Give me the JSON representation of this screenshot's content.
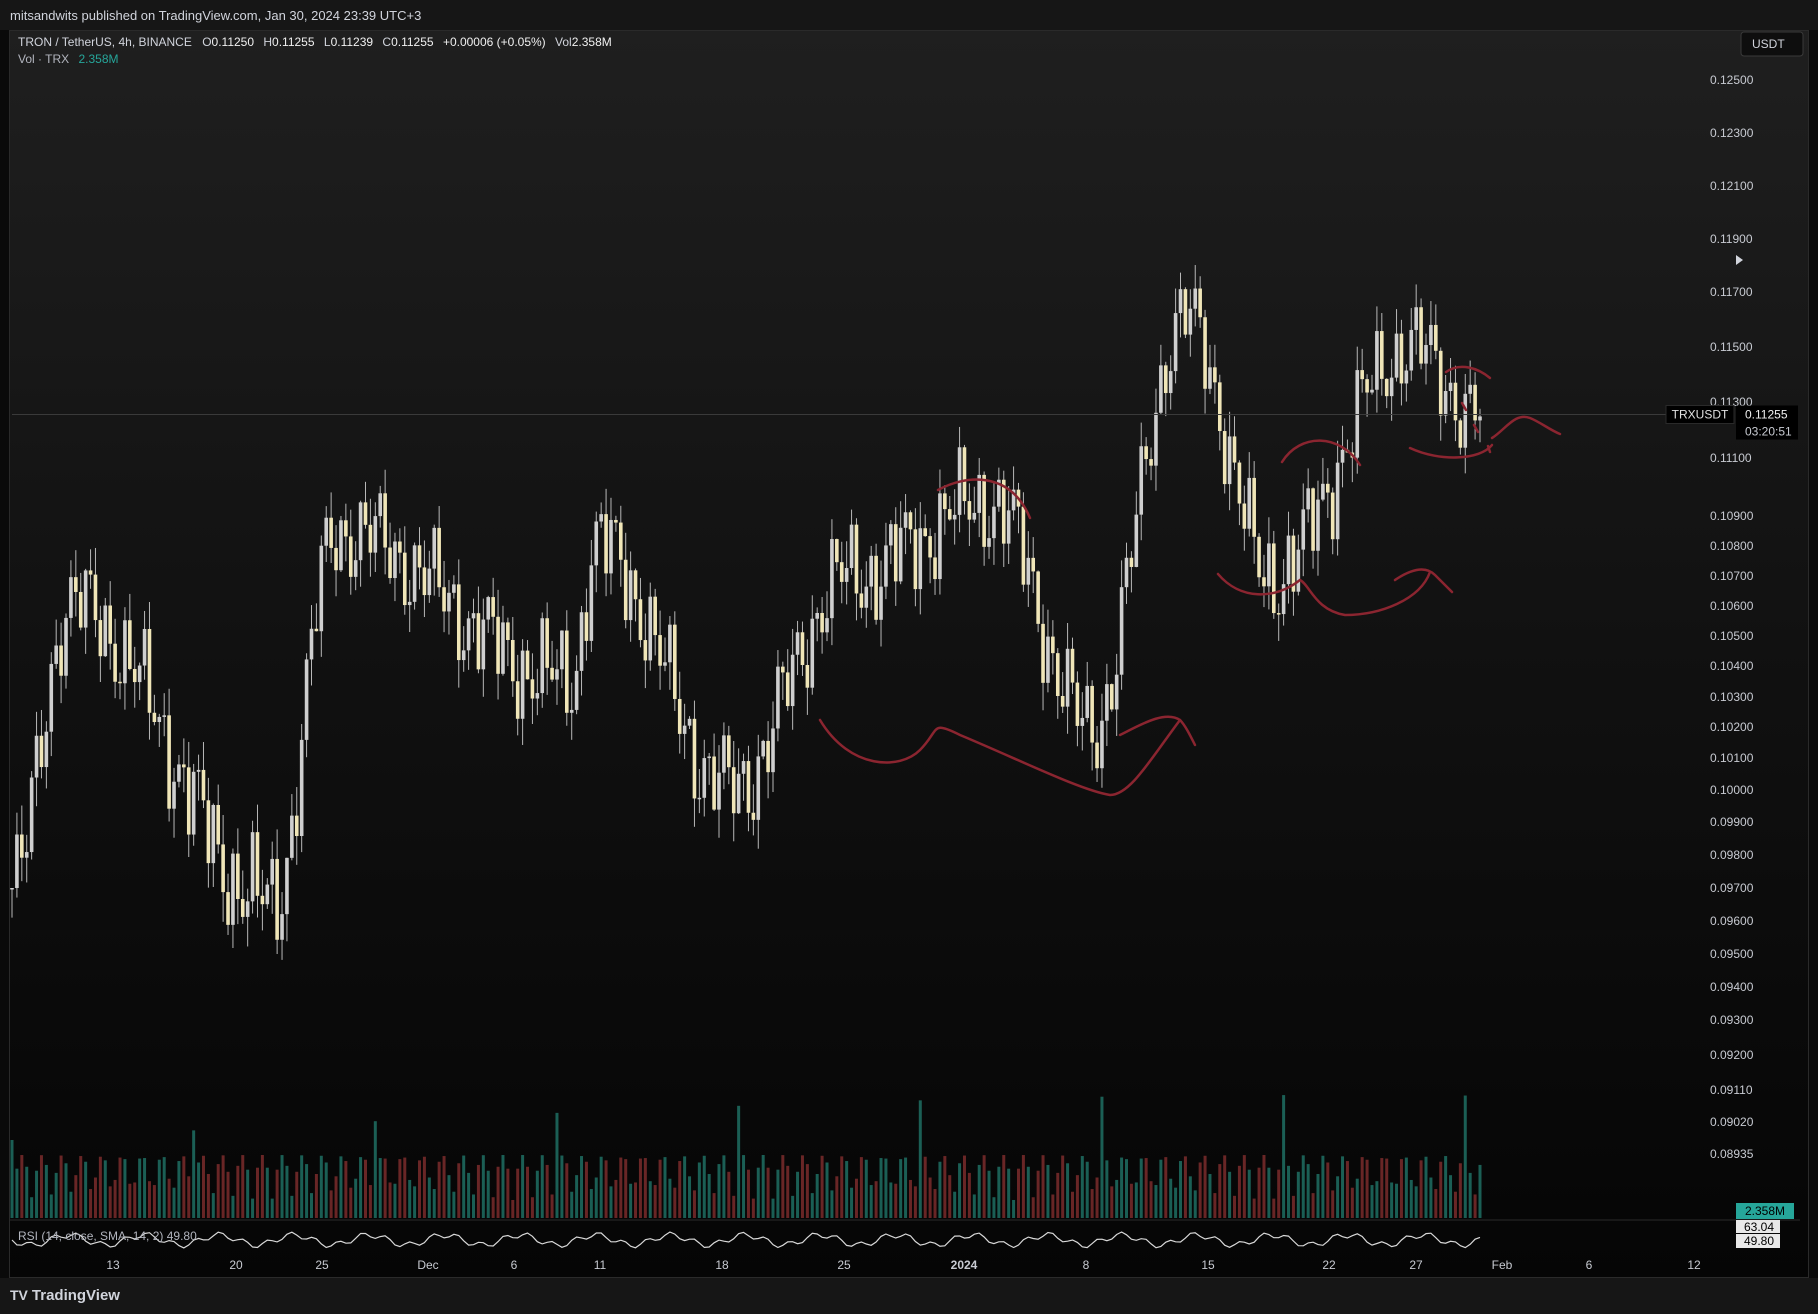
{
  "header": {
    "publish_text": "mitsandwits published on TradingView.com, Jan 30, 2024 23:39 UTC+3"
  },
  "legend": {
    "symbol_text": "TRON / TetherUS, 4h, BINANCE",
    "o_label": "O",
    "o_value": "0.11250",
    "h_label": "H",
    "h_value": "0.11255",
    "l_label": "L",
    "l_value": "0.11239",
    "c_label": "C",
    "c_value": "0.11255",
    "change": "+0.00006 (+0.05%)",
    "vol_label": "Vol",
    "vol_value": "2.358M",
    "vol_series_label": "Vol · TRX",
    "vol_series_value": "2.358M"
  },
  "currency_button": "USDT",
  "price_scale": {
    "ticks": [
      "0.12500",
      "0.12300",
      "0.12100",
      "0.11900",
      "0.11700",
      "0.11500",
      "0.11300",
      "0.11100",
      "0.10900",
      "0.10800",
      "0.10700",
      "0.10600",
      "0.10500",
      "0.10400",
      "0.10300",
      "0.10200",
      "0.10100",
      "0.10000",
      "0.09900",
      "0.09800",
      "0.09700",
      "0.09600",
      "0.09500",
      "0.09400",
      "0.09300",
      "0.09200",
      "0.09110",
      "0.09020",
      "0.08935"
    ]
  },
  "last_price": {
    "symbol": "TRXUSDT",
    "price": "0.11255",
    "countdown": "03:20:51"
  },
  "volume_badge": "2.358M",
  "rsi": {
    "label": "RSI (14, close, SMA, 14, 2)  49.80",
    "badge_top": "63.04",
    "badge_bottom": "49.80"
  },
  "time_axis": {
    "labels": [
      "13",
      "20",
      "25",
      "Dec",
      "6",
      "11",
      "18",
      "25",
      "2024",
      "8",
      "15",
      "22",
      "27",
      "Feb",
      "6",
      "12"
    ]
  },
  "footer": {
    "brand": "TradingView",
    "logo": "TV"
  },
  "colors": {
    "candle": "#f0e6b8",
    "wick": "#b8b8b8",
    "annotation": "#8b2530",
    "vol_up": "#1f6f63",
    "vol_down": "#7a2b2b",
    "background": "#0a0a0a"
  },
  "chart_data": {
    "type": "line",
    "title": "TRON / TetherUS, 4h, BINANCE",
    "x": [
      "13",
      "20",
      "25",
      "Dec",
      "6",
      "11",
      "18",
      "25",
      "2024",
      "8",
      "15",
      "22",
      "27",
      "Feb"
    ],
    "series": [
      {
        "values": [
          0.097,
          0.106,
          0.0965,
          0.1085,
          0.1035,
          0.108,
          0.1,
          0.107,
          0.1095,
          0.102,
          0.116,
          0.107,
          0.115,
          0.1125
        ]
      }
    ],
    "ylim": [
      0.08935,
      0.125
    ],
    "y_scale": "log",
    "grid": false,
    "annotations": "hand-drawn red arcs marking rounded bottoms and tops"
  }
}
